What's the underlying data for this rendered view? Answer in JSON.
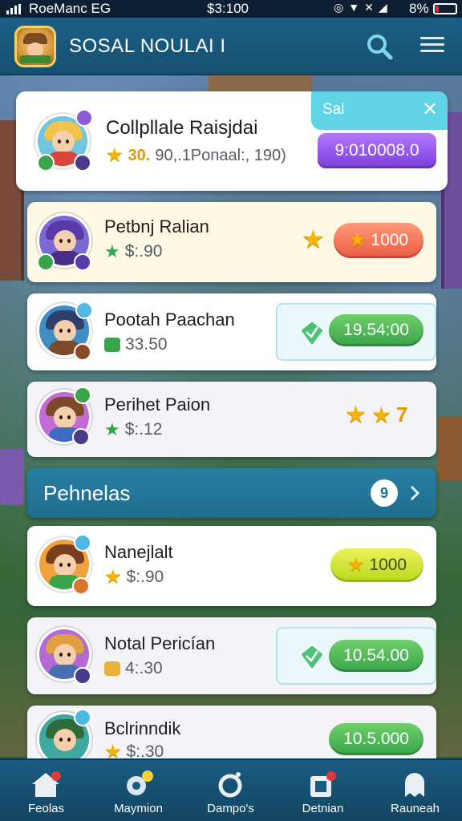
{
  "status_bar": {
    "carrier": "RoeManc  EG",
    "time": "$3:100",
    "battery": "8%"
  },
  "header": {
    "title": "SOSAL NOULAI I",
    "logo_icon": "game-logo-icon",
    "search_icon": "search-icon",
    "menu_icon": "menu-icon"
  },
  "featured": {
    "name": "Collpllale Raisjdai",
    "rating": "30.",
    "stats": "90,.1Ponaal:, 190)",
    "tag": "Sal",
    "action": "9:010008.0"
  },
  "list_top": [
    {
      "name": "Petbnj Ralian",
      "value": "$:.90",
      "action": "1000"
    },
    {
      "name": "Pootah Paachan",
      "value": "33.50",
      "action": "19.54:00"
    },
    {
      "name": "Perihet Paion",
      "value": "$:.12",
      "stars_count": "7"
    }
  ],
  "section": {
    "title": "Pehnelas",
    "count": "9"
  },
  "list_bottom": [
    {
      "name": "Nanejlalt",
      "value": "$:.90",
      "action": "1000"
    },
    {
      "name": "Notal Pericían",
      "value": "4:.30",
      "action": "10.54.00"
    },
    {
      "name": "Bclrinndik",
      "value": "$:.30",
      "action": "10.5.000"
    }
  ],
  "nav": [
    {
      "label": "Feolas",
      "icon": "home-icon"
    },
    {
      "label": "Maymion",
      "icon": "gear-icon"
    },
    {
      "label": "Dampo's",
      "icon": "ring-icon"
    },
    {
      "label": "Detnian",
      "icon": "card-icon"
    },
    {
      "label": "Rauneah",
      "icon": "ghost-icon"
    }
  ],
  "colors": {
    "header": "#1c5f86",
    "accent_green": "#3aa44a",
    "accent_purple": "#7a3fd9",
    "star": "#f5b400",
    "section": "#267fa1"
  }
}
